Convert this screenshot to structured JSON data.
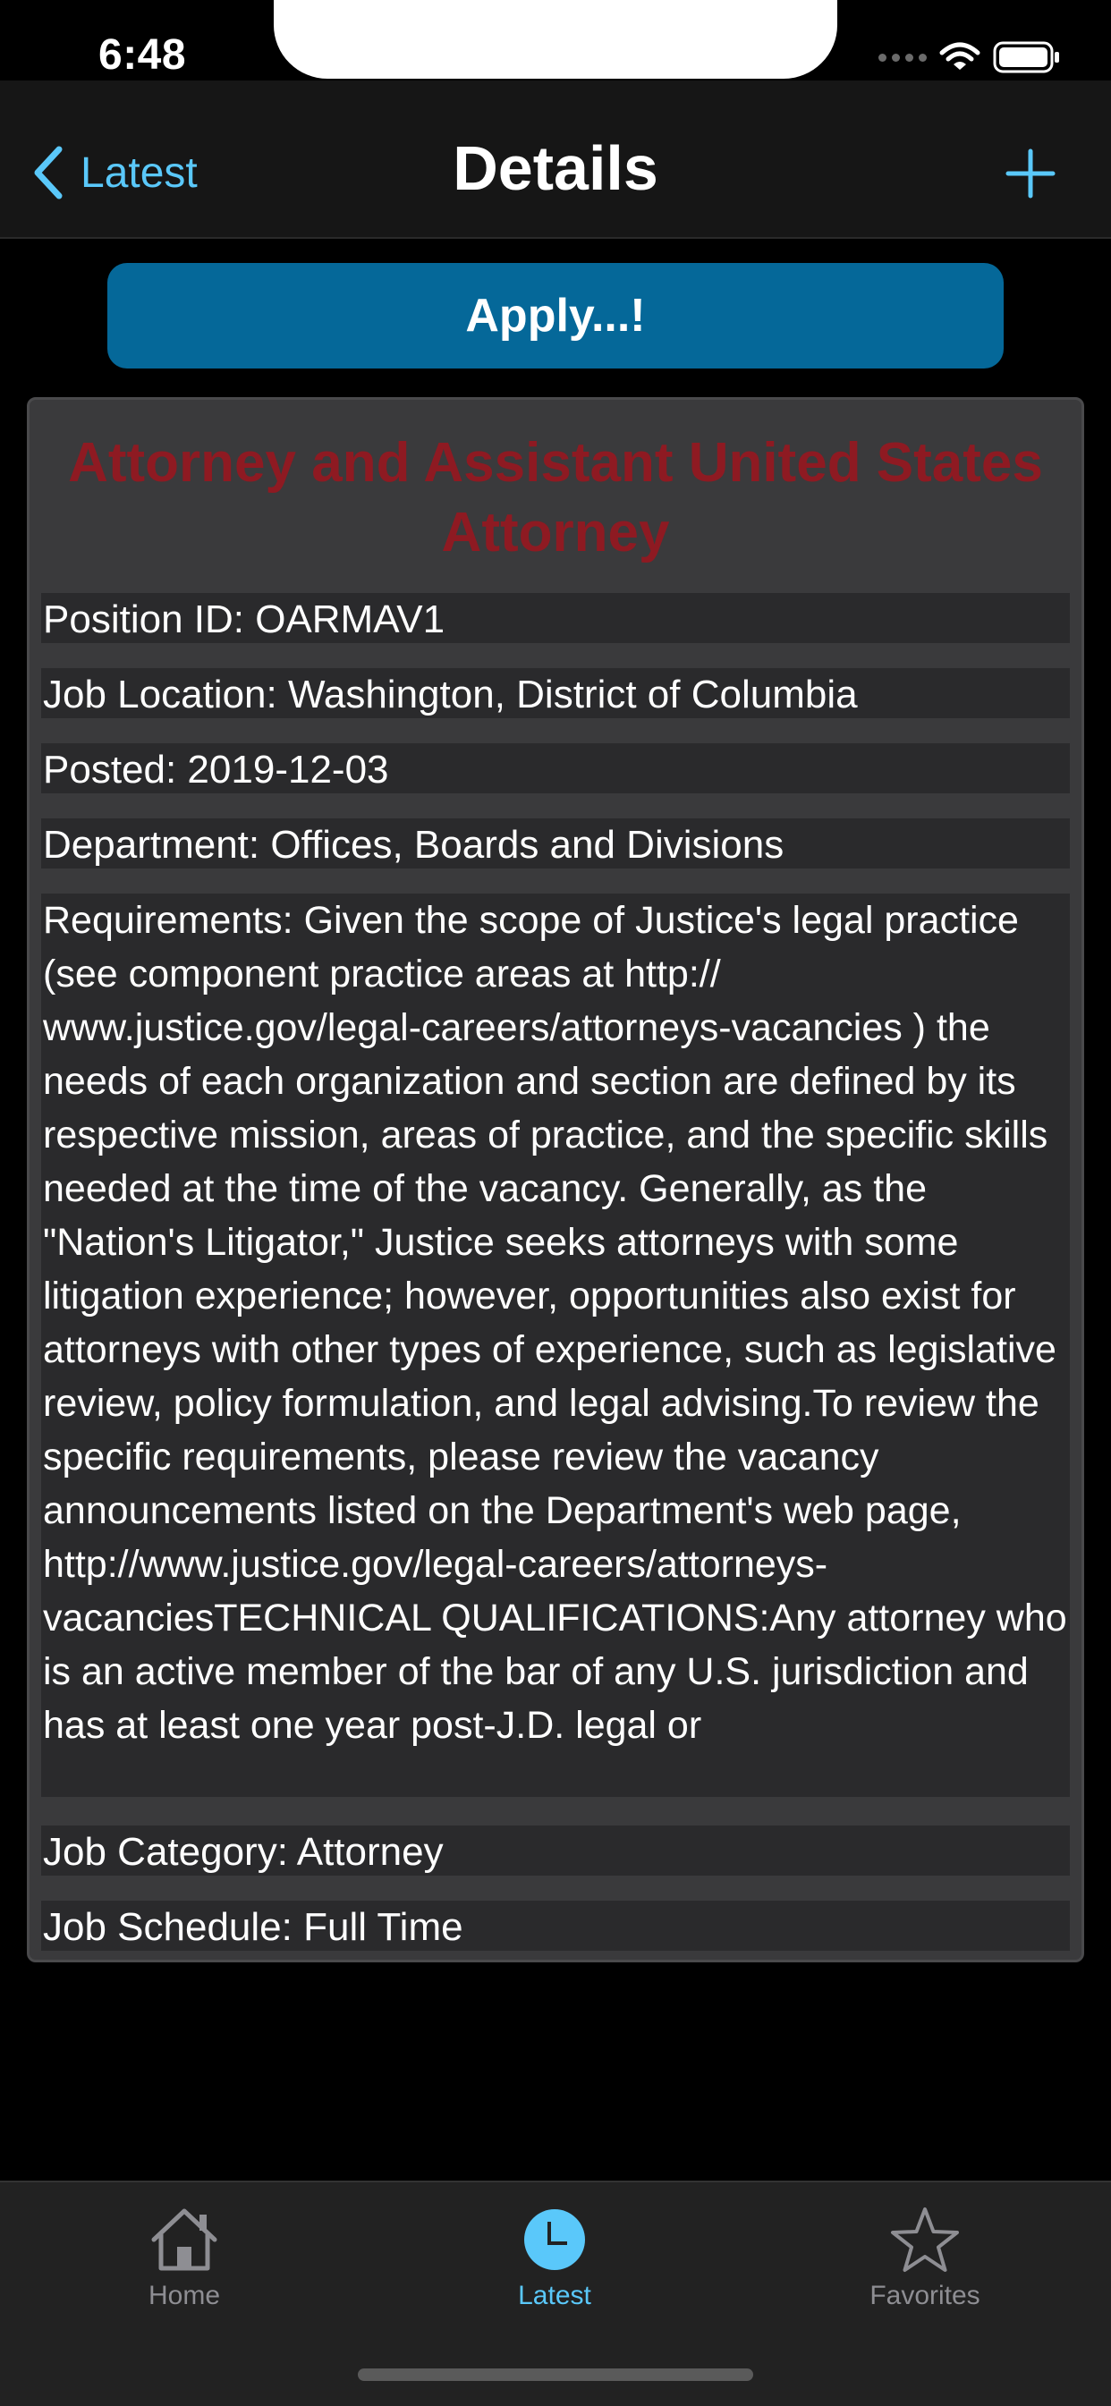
{
  "status_bar": {
    "time": "6:48"
  },
  "nav": {
    "back_label": "Latest",
    "title": "Details"
  },
  "apply_label": "Apply...!",
  "job": {
    "title": "Attorney and Assistant United States Attorney",
    "position_id": "Position ID: OARMAV1",
    "location": "Job Location: Washington, District of Columbia",
    "posted": "Posted: 2019-12-03",
    "department": "Department: Offices, Boards and Divisions",
    "requirements": "Requirements: Given the scope of Justice's legal practice (see component practice areas at http:// www.justice.gov/legal-careers/attorneys-vacancies ) the needs of each organization and section are defined by its respective mission, areas of practice, and the specific skills needed at the time of the vacancy. Generally, as the \"Nation's Litigator,\" Justice seeks attorneys with some litigation experience; however, opportunities also exist for attorneys with other types of experience, such as legislative review, policy formulation, and legal advising.To review the specific requirements, please review the vacancy announcements listed on the Department's web page, http://www.justice.gov/legal-careers/attorneys-vacanciesTECHNICAL QUALIFICATIONS:Any attorney who is an active member of the bar of any U.S. jurisdiction and has at least one year post-J.D. legal or",
    "category": "Job Category: Attorney",
    "schedule": "Job Schedule: Full Time"
  },
  "tabs": [
    {
      "label": "Home",
      "icon": "house-icon",
      "active": false
    },
    {
      "label": "Latest",
      "icon": "clock-icon",
      "active": true
    },
    {
      "label": "Favorites",
      "icon": "star-icon",
      "active": false
    }
  ],
  "colors": {
    "accent": "#5ac8fa",
    "apply_button": "#056899",
    "title_red": "#8e1a22",
    "inactive_tab": "#8e8e93"
  }
}
